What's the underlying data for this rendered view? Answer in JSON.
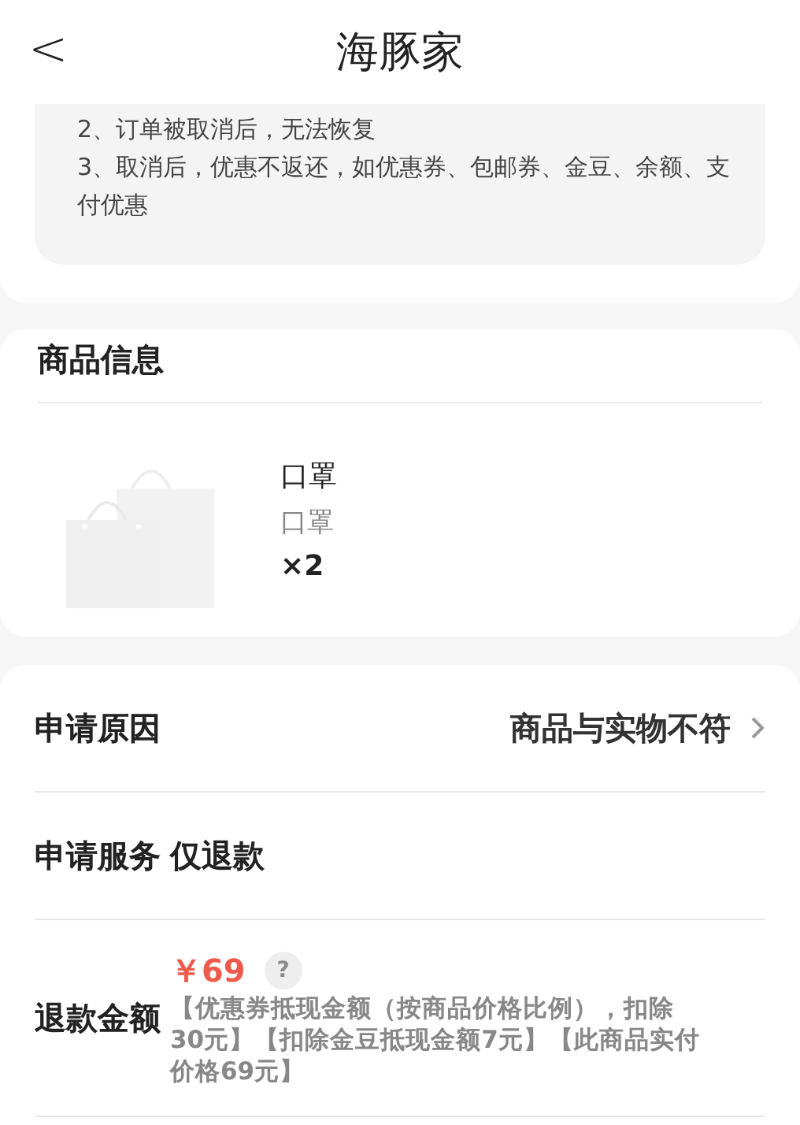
{
  "header": {
    "back": "<",
    "title": "海豚家"
  },
  "notice": {
    "lines": [
      "2、订单被取消后，无法恢复",
      "3、取消后，优惠不返还，如优惠券、包邮券、金豆、余额、支付优惠"
    ]
  },
  "product_section": {
    "title": "商品信息",
    "item": {
      "name": "口罩",
      "spec": "口罩",
      "quantity": "×2"
    }
  },
  "form": {
    "reason": {
      "label": "申请原因",
      "value": "商品与实物不符"
    },
    "service": {
      "label": "申请服务",
      "value": "仅退款"
    },
    "refund": {
      "label": "退款金额",
      "amount": "￥69",
      "help": "?",
      "note": "【优惠券抵现金额（按商品价格比例），扣除30元】【扣除金豆抵现金额7元】【此商品实付价格69元】"
    }
  }
}
